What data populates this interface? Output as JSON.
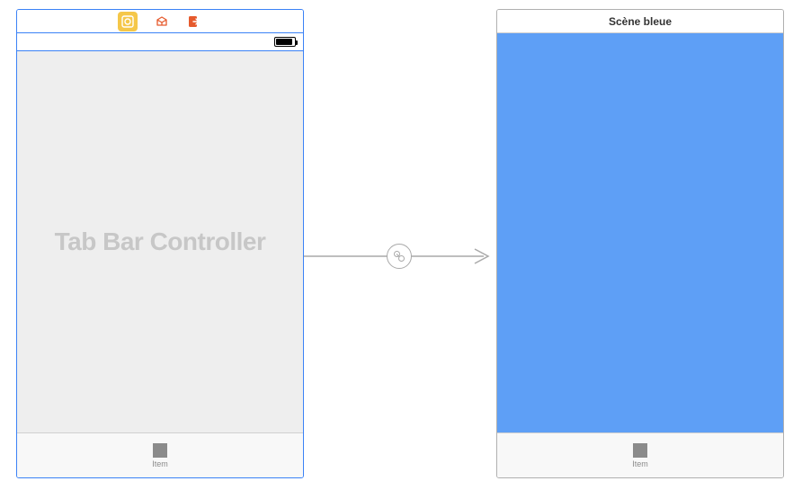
{
  "scenes": {
    "left": {
      "title_placeholder": "Tab Bar Controller",
      "tab_item_label": "Item"
    },
    "right": {
      "title": "Scène bleue",
      "tab_item_label": "Item"
    }
  },
  "colors": {
    "blue_bg": "#5e9ff6",
    "selection": "#3b82f6"
  }
}
